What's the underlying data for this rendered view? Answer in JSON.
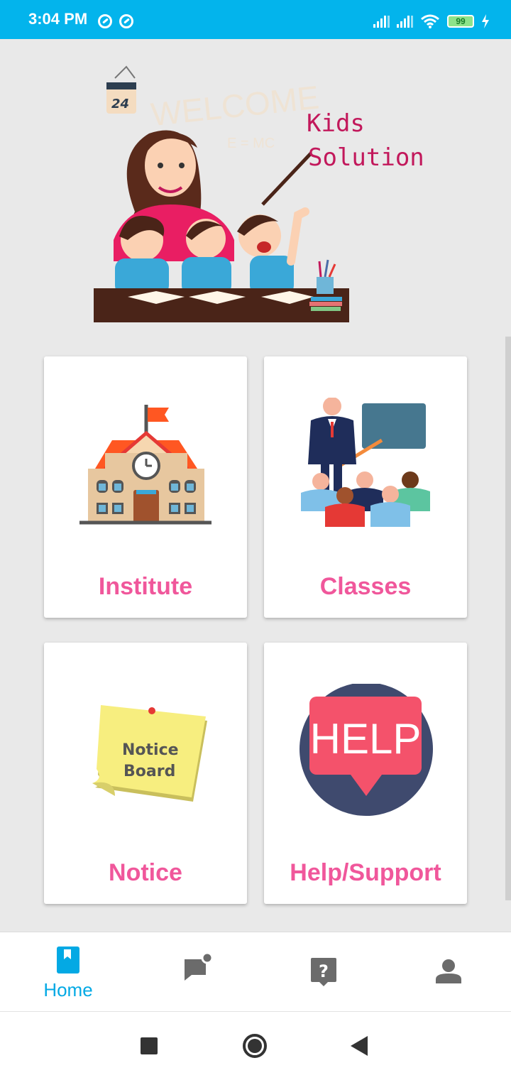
{
  "status": {
    "time": "3:04 PM",
    "battery": "99"
  },
  "hero": {
    "title_line1": "Kids",
    "title_line2": "Solution",
    "board_text": "WELCOME",
    "calendar_day": "24"
  },
  "cards": [
    {
      "label": "Institute",
      "icon": "school-building-icon"
    },
    {
      "label": "Classes",
      "icon": "teacher-classroom-icon"
    },
    {
      "label": "Notice",
      "icon": "notice-board-icon",
      "icon_text_1": "Notice",
      "icon_text_2": "Board"
    },
    {
      "label": "Help/Support",
      "icon": "help-bubble-icon",
      "icon_text": "HELP"
    }
  ],
  "bottom_nav": {
    "active_color": "#03a9e4",
    "items": [
      {
        "label": "Home",
        "icon": "home-book-icon",
        "active": true
      },
      {
        "label": "",
        "icon": "chat-notification-icon"
      },
      {
        "label": "",
        "icon": "help-question-icon"
      },
      {
        "label": "",
        "icon": "profile-icon"
      }
    ]
  },
  "colors": {
    "status_bar": "#03b4ec",
    "accent_pink": "#f0579b",
    "title_magenta": "#c2185b"
  }
}
